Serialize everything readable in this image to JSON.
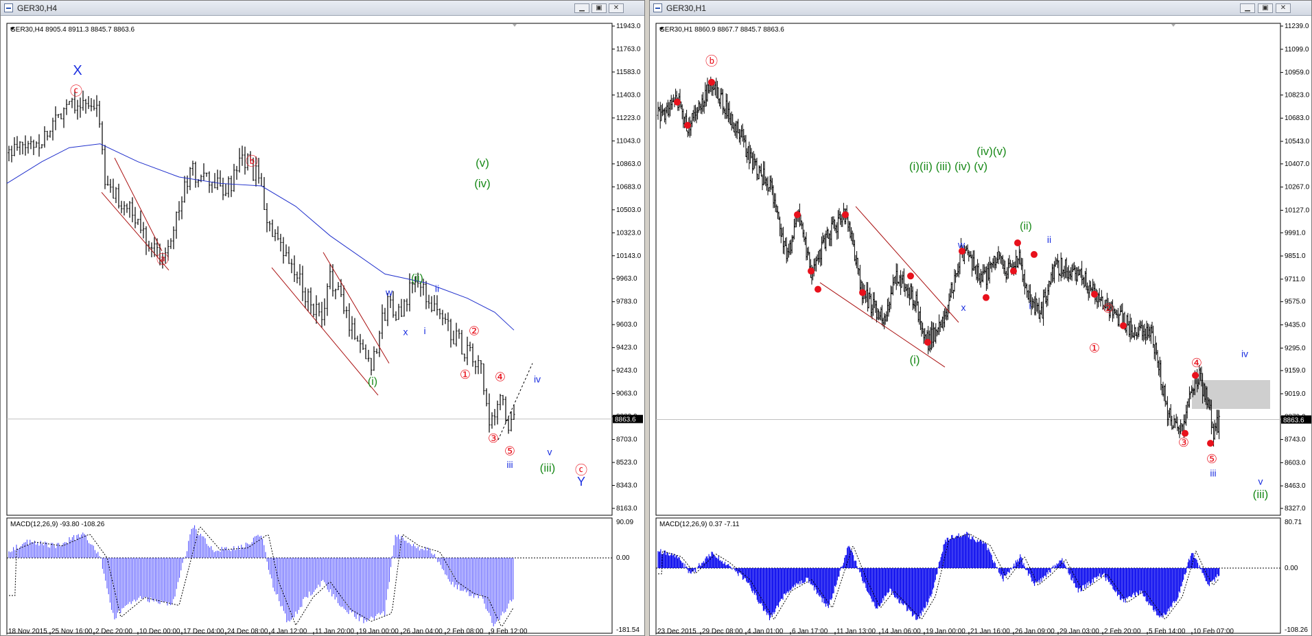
{
  "left": {
    "window_title": "GER30,H4",
    "info": "GER30,H4  8905.4 8911.3 8845.7 8863.6",
    "price_ticks": [
      "11943.0",
      "11763.0",
      "11583.0",
      "11403.0",
      "11223.0",
      "11043.0",
      "10863.0",
      "10683.0",
      "10503.0",
      "10323.0",
      "10143.0",
      "9963.0",
      "9783.0",
      "9603.0",
      "9423.0",
      "9243.0",
      "9063.0",
      "8883.0",
      "8703.0",
      "8523.0",
      "8343.0",
      "8163.0"
    ],
    "current_price": "8863.6",
    "macd_title": "MACD(12,26,9) -93.80 -108.26",
    "macd_ticks": [
      "90.09",
      "0.00",
      "-181.54"
    ],
    "time_ticks": [
      "18 Nov 2015",
      "25 Nov 16:00",
      "2 Dec 20:00",
      "10 Dec 00:00",
      "17 Dec 04:00",
      "24 Dec 08:00",
      "4 Jan 12:00",
      "11 Jan 20:00",
      "19 Jan 00:00",
      "26 Jan 04:00",
      "2 Feb 08:00",
      "9 Feb 12:00"
    ],
    "labels": {
      "X": "X",
      "c": "ⓒ",
      "b": "ⓑ",
      "a": "ⓐ",
      "v_top": "(v)",
      "iv_top": "(iv)",
      "w": "w",
      "x": "x",
      "ii_green": "(ii)",
      "ii_blue": "ii",
      "i_blue": "i",
      "i_green": "(i)",
      "two": "②",
      "one": "①",
      "four": "④",
      "three": "③",
      "five": "⑤",
      "iii_blue": "iii",
      "iv_blue": "iv",
      "v_blue": "v",
      "iii_green": "(iii)",
      "c2": "ⓒ",
      "Y": "Y"
    }
  },
  "right": {
    "window_title": "GER30,H1",
    "info": "GER30,H1  8860.9 8867.7 8845.7 8863.6",
    "price_ticks": [
      "11239.0",
      "11099.0",
      "10959.0",
      "10823.0",
      "10683.0",
      "10543.0",
      "10407.0",
      "10267.0",
      "10127.0",
      "9991.0",
      "9851.0",
      "9711.0",
      "9575.0",
      "9435.0",
      "9295.0",
      "9159.0",
      "9019.0",
      "8879.0",
      "8743.0",
      "8603.0",
      "8463.0",
      "8327.0"
    ],
    "current_price": "8863.6",
    "macd_title": "MACD(12,26,9) 0.37 -7.11",
    "macd_ticks": [
      "80.71",
      "0.00",
      "-108.26"
    ],
    "time_ticks": [
      "23 Dec 2015",
      "29 Dec 08:00",
      "4 Jan 01:00",
      "6 Jan 17:00",
      "11 Jan 13:00",
      "14 Jan 06:00",
      "19 Jan 00:00",
      "21 Jan 16:00",
      "26 Jan 09:00",
      "29 Jan 03:00",
      "2 Feb 20:00",
      "5 Feb 14:00",
      "10 Feb 07:00"
    ],
    "labels": {
      "b": "ⓑ",
      "green_row": "(i)(ii) (iii) (iv) (v)",
      "green_row2": "(iv)(v)",
      "w": "w",
      "ii_green": "(ii)",
      "ii_blue": "ii",
      "x": "x",
      "i_blue": "i",
      "i_green": "(i)",
      "two": "②",
      "one": "①",
      "four": "④",
      "three": "③",
      "five": "⑤",
      "iii_blue": "iii",
      "iv_blue": "iv",
      "v_blue": "v",
      "iii_green": "(iii)"
    }
  },
  "chart_data": [
    {
      "type": "line",
      "title": "GER30,H4",
      "x": [
        "18 Nov 2015",
        "25 Nov 16:00",
        "2 Dec 20:00",
        "10 Dec 00:00",
        "17 Dec 04:00",
        "24 Dec 08:00",
        "4 Jan 12:00",
        "11 Jan 20:00",
        "19 Jan 00:00",
        "26 Jan 04:00",
        "2 Feb 08:00",
        "9 Feb 12:00"
      ],
      "series": [
        {
          "name": "GER30",
          "values": [
            10950,
            11300,
            10850,
            10300,
            10750,
            10700,
            10150,
            9850,
            9350,
            9750,
            9500,
            8860
          ]
        },
        {
          "values": [
            10700,
            10980,
            11020,
            10860,
            10760,
            10690,
            10520,
            10230,
            9980,
            9910,
            9760,
            9560
          ]
        }
      ],
      "ylim": [
        8163,
        11943
      ],
      "current_price": 8863.6,
      "macd": {
        "ylim": [
          -181.54,
          90.09
        ],
        "last": -93.8,
        "signal": -108.26
      }
    },
    {
      "type": "line",
      "title": "GER30,H1",
      "x": [
        "23 Dec 2015",
        "29 Dec 08:00",
        "4 Jan 01:00",
        "6 Jan 17:00",
        "11 Jan 13:00",
        "14 Jan 06:00",
        "19 Jan 00:00",
        "21 Jan 16:00",
        "26 Jan 09:00",
        "29 Jan 03:00",
        "2 Feb 20:00",
        "5 Feb 14:00",
        "10 Feb 07:00"
      ],
      "series": [
        {
          "name": "GER30",
          "values": [
            10700,
            10850,
            10400,
            9800,
            10100,
            9450,
            9300,
            9880,
            9950,
            9800,
            9400,
            8800,
            8860
          ]
        }
      ],
      "ylim": [
        8327,
        11239
      ],
      "current_price": 8863.6,
      "macd": {
        "ylim": [
          -108.26,
          80.71
        ],
        "last": 0.37,
        "signal": -7.11
      }
    }
  ],
  "colors": {
    "red": "#e8111c",
    "green": "#1a8a1a",
    "blue": "#1a2ee0",
    "ma": "#1f2fcc",
    "macd": "#3a3aff"
  }
}
